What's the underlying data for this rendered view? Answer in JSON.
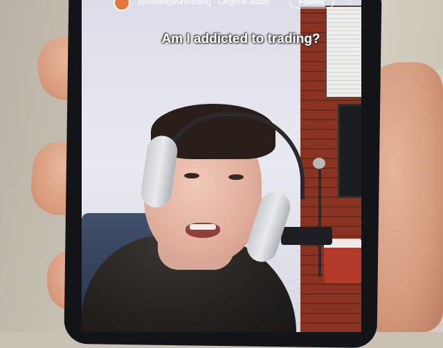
{
  "post": {
    "audio_line": "@tradingwithtrading · Original audio",
    "follow_label": "Follow",
    "caption": "Am I addicted to trading?"
  },
  "icons": {
    "more": "more-vertical-icon",
    "avatar": "avatar"
  },
  "colors": {
    "caption_text": "#ffffff",
    "brick": "#8b3322",
    "phone_body": "#121417"
  }
}
